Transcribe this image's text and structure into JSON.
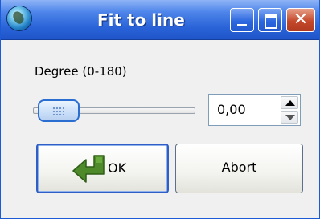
{
  "window": {
    "title": "Fit to line",
    "icons": {
      "app": "globe-icon",
      "minimize": "minimize-icon",
      "maximize": "maximize-icon",
      "close": "close-icon"
    },
    "close_glyph": "✕"
  },
  "form": {
    "degree_label": "Degree (0-180)",
    "slider": {
      "min": 0,
      "max": 180,
      "value": 0
    },
    "spin_value": "0,00"
  },
  "buttons": {
    "ok_label": "OK",
    "ok_icon": "green-return-arrow-icon",
    "abort_label": "Abort"
  },
  "colors": {
    "titlebar": "#2a63d8",
    "close_button": "#c5492b",
    "ok_arrow": "#4e8a2a"
  }
}
